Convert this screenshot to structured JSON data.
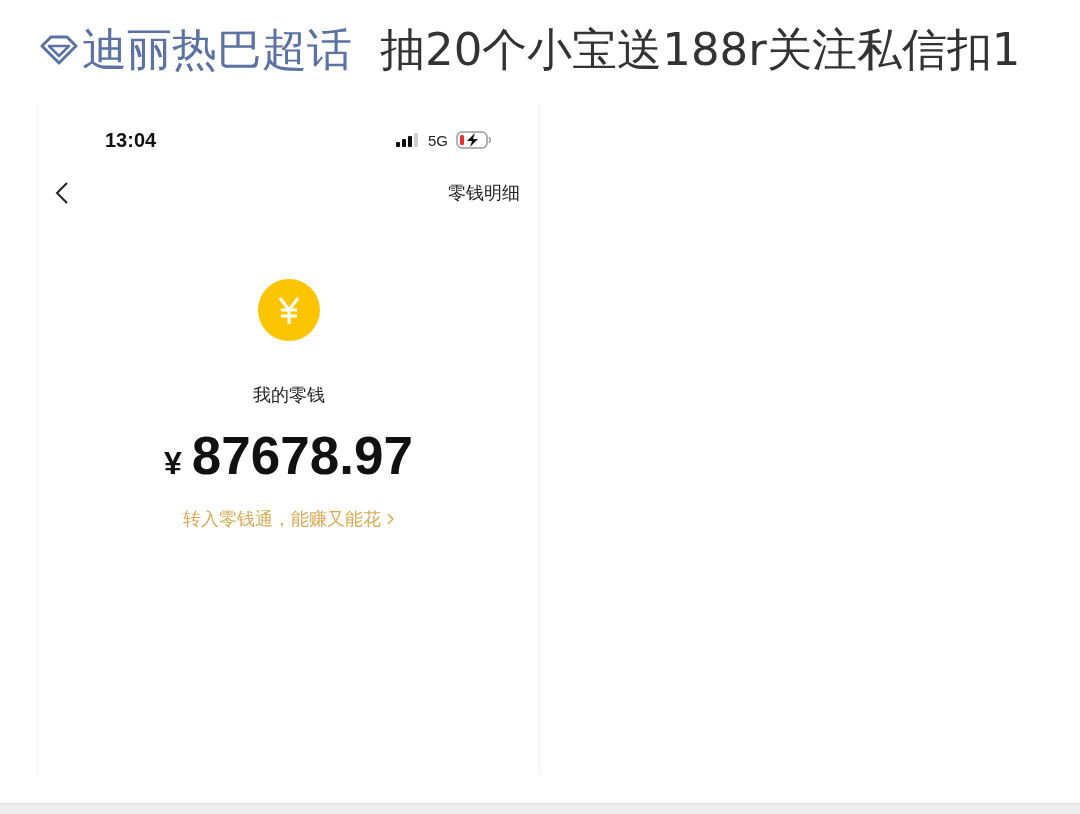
{
  "post": {
    "topic": {
      "label": "迪丽热巴超话"
    },
    "title": "抽20个小宝送188r关注私信扣1"
  },
  "screenshot": {
    "status_bar": {
      "time": "13:04",
      "network": "5G"
    },
    "nav": {
      "right_link": "零钱明细"
    },
    "balance": {
      "label": "我的零钱",
      "currency": "¥",
      "amount": "87678.97",
      "promo": "转入零钱通，能赚又能花"
    }
  }
}
